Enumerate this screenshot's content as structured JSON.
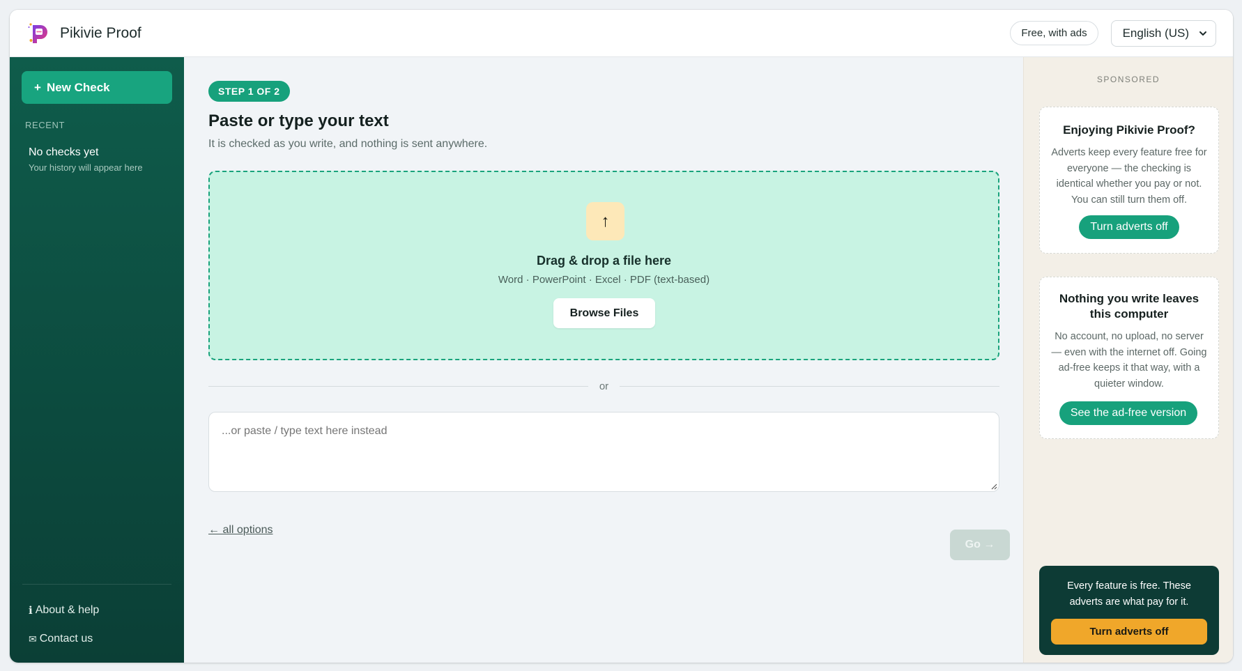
{
  "app": {
    "title": "Pikivie Proof",
    "free_badge": "Free, with ads",
    "language": "English (US)"
  },
  "sidebar": {
    "new_check_plus": "+",
    "new_check_label": "New Check",
    "recent_label": "RECENT",
    "empty_title": "No checks yet",
    "empty_hint": "Your history will appear here",
    "about_icon": "i",
    "about_label": "About & help",
    "contact_icon": "✉",
    "contact_label": "Contact us"
  },
  "main": {
    "step_badge": "STEP 1 OF 2",
    "title": "Paste or type your text",
    "subtitle": "It is checked as you write, and nothing is sent anywhere.",
    "upload_icon": "↑",
    "drop_title": "Drag & drop a file here",
    "drop_types": "Word · PowerPoint · Excel · PDF (text-based)",
    "browse_label": "Browse Files",
    "or_label": "or",
    "text_placeholder": "...or paste / type text here instead",
    "back_link": "← all options",
    "go_label": "Go →"
  },
  "ads": {
    "sponsored_label": "SPONSORED",
    "card1_title": "Enjoying Pikivie Proof?",
    "card1_body": "Adverts keep every feature free for everyone — the checking is identical whether you pay or not. You can still turn them off.",
    "card1_button": "Turn adverts off",
    "card2_title": "Nothing you write leaves this computer",
    "card2_body": "No account, no upload, no server — even with the internet off. Going ad-free keeps it that way, with a quieter window.",
    "card2_button": "See the ad-free version",
    "dark_text": "Every feature is free. These adverts are what pay for it.",
    "dark_button": "Turn adverts off"
  },
  "colors": {
    "accent": "#18a47f",
    "sidebar_bg": "#0c4a3e",
    "dropzone_bg": "#c8f3e3",
    "ad_rail_bg": "#f3efe7",
    "dark_card_bg": "#0d3b35",
    "warning_button": "#f0a72a"
  },
  "icons": {
    "logo": "pikivie-logo-icon",
    "upload": "upload-arrow-icon",
    "chevron": "chevron-down-icon",
    "info": "info-icon",
    "mail": "mail-icon"
  }
}
